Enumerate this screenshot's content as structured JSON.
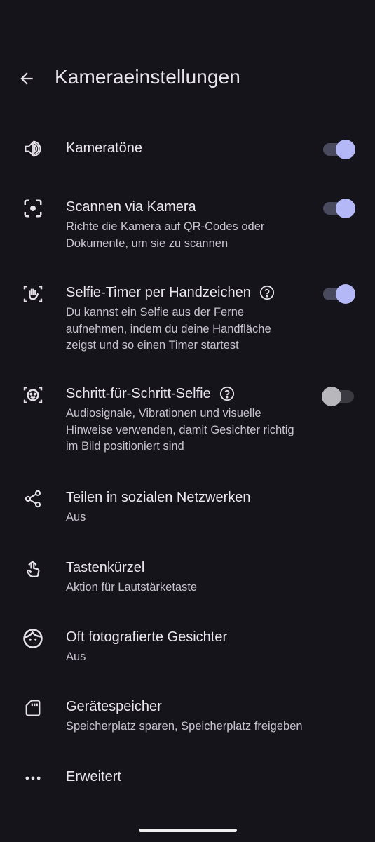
{
  "header": {
    "title": "Kameraeinstellungen",
    "back_icon": "arrow-back-icon"
  },
  "colors": {
    "background": "#15141a",
    "switch_on_knob": "#b4b8f6",
    "switch_off_knob": "#b8b7bc",
    "text_primary": "#ebe6ef",
    "text_secondary": "#c9c3cf"
  },
  "settings": [
    {
      "title": "Kameratöne",
      "subtitle": "",
      "icon": "speaker-icon",
      "toggle": true
    },
    {
      "title": "Scannen via Kamera",
      "subtitle": "Richte die Kamera auf QR-Codes oder Dokumente, um sie zu scannen",
      "icon": "scan-icon",
      "toggle": true
    },
    {
      "title": "Selfie-Timer per Handzeichen",
      "subtitle": "Du kannst ein Selfie aus der Ferne aufnehmen, indem du deine Handfläche zeigst und so einen Timer startest",
      "icon": "palm-gesture-icon",
      "help": true,
      "toggle": true
    },
    {
      "title": "Schritt-für-Schritt-Selfie",
      "subtitle": "Audiosignale, Vibrationen und visuelle Hinweise verwenden, damit Gesichter richtig im Bild positioniert sind",
      "icon": "face-frame-icon",
      "help": true,
      "toggle": false
    },
    {
      "title": "Teilen in sozialen Netzwerken",
      "subtitle": "Aus",
      "icon": "share-icon"
    },
    {
      "title": "Tastenkürzel",
      "subtitle": "Aktion für Lautstärketaste",
      "icon": "touch-icon"
    },
    {
      "title": "Oft fotografierte Gesichter",
      "subtitle": "Aus",
      "icon": "face-icon"
    },
    {
      "title": "Gerätespeicher",
      "subtitle": "Speicherplatz sparen, Speicherplatz freigeben",
      "icon": "sd-card-icon"
    },
    {
      "title": "Erweitert",
      "subtitle": "",
      "icon": "more-horiz-icon"
    }
  ]
}
